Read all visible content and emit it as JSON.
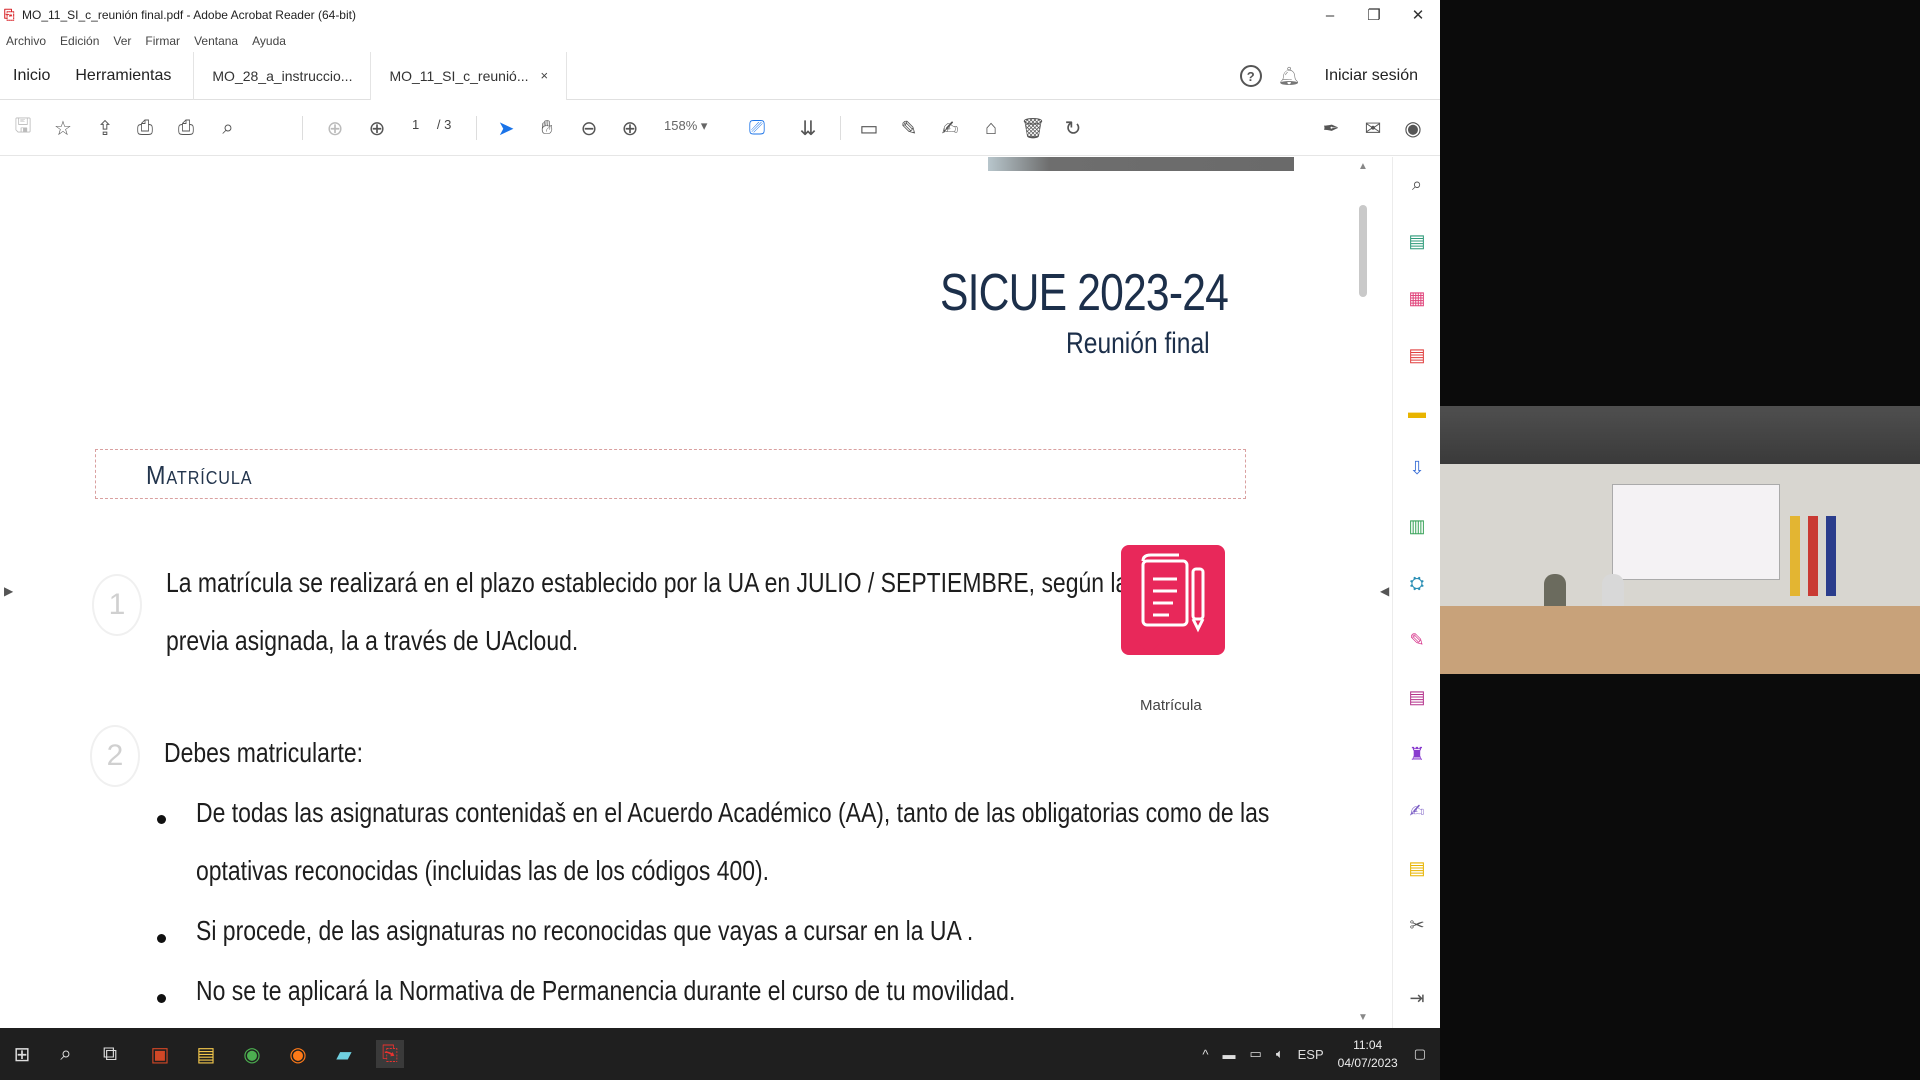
{
  "window": {
    "title": "MO_11_SI_c_reunión final.pdf - Adobe Acrobat Reader (64-bit)",
    "minimize": "–",
    "maximize": "❐",
    "close": "✕"
  },
  "menu": [
    "Archivo",
    "Edición",
    "Ver",
    "Firmar",
    "Ventana",
    "Ayuda"
  ],
  "nav_tabs": [
    "Inicio",
    "Herramientas"
  ],
  "doc_tabs": [
    {
      "label": "MO_28_a_instruccio..."
    },
    {
      "label": "MO_11_SI_c_reunió...",
      "close": "×"
    }
  ],
  "header_right": {
    "help": "?",
    "signin": "Iniciar sesión"
  },
  "toolbar": {
    "page_current": "1",
    "page_total": "/ 3",
    "zoom": "158%"
  },
  "document": {
    "title": "SICUE 2023-24",
    "subtitle": "Reunión final",
    "section_title": "Matrícula",
    "item1_number": "1",
    "item1_line1": "La matrícula se realizará en el plazo establecido por la UA en JULIO / SEPTIEMBRE, según la cita",
    "item1_line2": "previa asignada, la a través de UAcloud.",
    "icon_label": "Matrícula",
    "item2_number": "2",
    "item2_text": "Debes matricularte:",
    "bullet1_line1": "De todas las asignaturas contenidaš en el Acuerdo Académico (AA), tanto de las obligatorias como de las",
    "bullet1_line2": "optativas reconocidas (incluidas las de los códigos 400).",
    "bullet2": "Si procede, de las asignaturas no reconocidas que vayas a cursar en la UA .",
    "bullet3": "No se te aplicará la Normativa de Permanencia durante el curso de tu movilidad."
  },
  "taskbar": {
    "language": "ESP",
    "time": "11:04",
    "date": "04/07/2023"
  },
  "colors": {
    "accent_pink": "#e8285a",
    "doc_navy": "#1c2f4a",
    "toolbar_blue": "#1a73e8"
  }
}
